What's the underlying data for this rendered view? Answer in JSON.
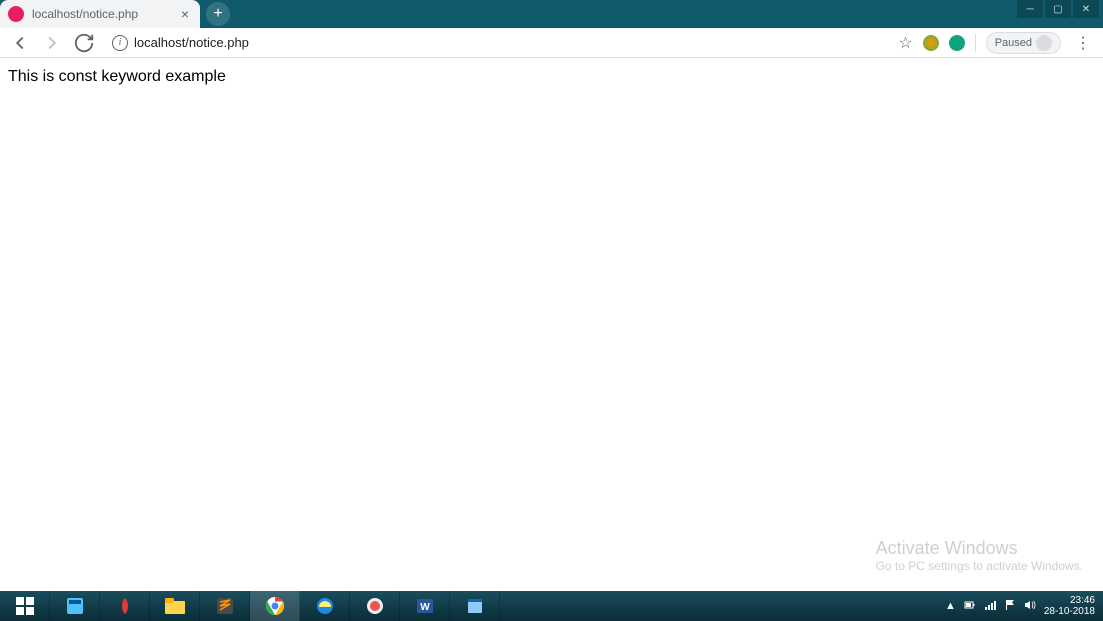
{
  "tab": {
    "title": "localhost/notice.php"
  },
  "address": {
    "url": "localhost/notice.php"
  },
  "toolbar": {
    "paused_label": "Paused"
  },
  "page": {
    "body_text": "This is const keyword example"
  },
  "watermark": {
    "title": "Activate Windows",
    "subtitle": "Go to PC settings to activate Windows."
  },
  "system": {
    "time": "23:46",
    "date": "28-10-2018"
  }
}
